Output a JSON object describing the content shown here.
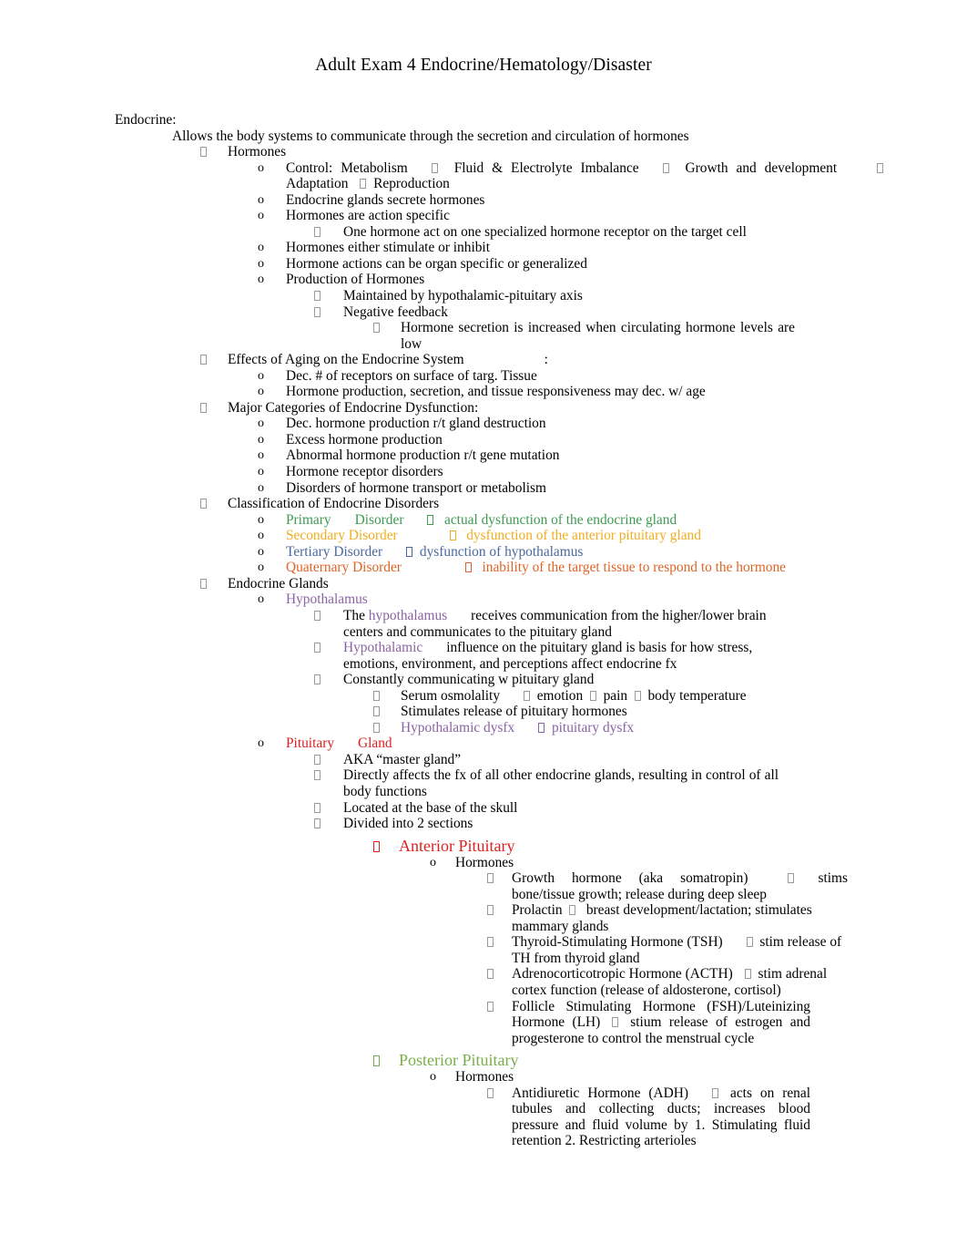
{
  "document": {
    "title": "Adult Exam 4 Endocrine/Hematology/Disaster",
    "bullet_glyph": "",
    "o_marker": "o",
    "colors": {
      "primary_green": "#3e9b52",
      "secondary_gold": "#f0ad1f",
      "tertiary_blue": "#49699e",
      "quaternary_orange": "#df6325",
      "hypothalamus_purple": "#8a63a3",
      "pituitary_red": "#dd2020",
      "posterior_green": "#79ad4b",
      "body_text": "#000000",
      "page_background": "#ffffff"
    }
  },
  "content": {
    "heading": "Endocrine:",
    "intro": "Allows the body systems to communicate through the secretion and circulation of hormones",
    "hormones_heading": "Hormones",
    "control_a": "Control: Metabolism",
    "control_b": "Fluid & Electrolyte Imbalance",
    "control_c": "Growth and development",
    "control_d": "Adaptation",
    "control_e": "Reproduction",
    "glands_secrete": "Endocrine glands secrete hormones",
    "action_specific": "Hormones are action specific",
    "one_hormone": "One hormone act on one specialized hormone receptor on the target cell",
    "stimulate_inhibit": "Hormones either stimulate or inhibit",
    "organ_specific": "Hormone actions can be organ specific or generalized",
    "production_of_hormones": "Production of Hormones",
    "maintained_by": "Maintained by hypothalamic-pituitary axis",
    "negative_feedback": "Negative feedback",
    "secretion_increased": "Hormone secretion is increased when circulating hormone levels are low",
    "effects_of_aging": "Effects of Aging on the Endocrine System",
    "effects_of_aging_colon": ":",
    "dec_receptors": "Dec. # of receptors on surface of targ. Tissue",
    "hormone_production_dec": "Hormone production, secretion, and tissue responsiveness may dec. w/ age",
    "major_categories": "Major Categories of Endocrine Dysfunction:",
    "dec_hormone_production": "Dec. hormone production r/t gland destruction",
    "excess_hormone": "Excess hormone production",
    "abnormal_hormone": "Abnormal hormone production r/t gene mutation",
    "receptor_disorders": "Hormone receptor disorders",
    "transport_disorders": "Disorders of hormone transport or metabolism",
    "classification": "Classification of Endocrine Disorders",
    "primary_label": "Primary",
    "primary_label2": "Disorder",
    "primary_def": "actual dysfunction of the endocrine gland",
    "secondary_label": "Secondary Disorder",
    "secondary_def": "dysfunction of the anterior pituitary gland",
    "tertiary_label": "Tertiary Disorder",
    "tertiary_def": "dysfunction of hypothalamus",
    "quaternary_label": "Quaternary Disorder",
    "quaternary_def": "inability of the target tissue to respond to the hormone",
    "endocrine_glands": "Endocrine Glands",
    "hypothalamus": "Hypothalamus",
    "the_word": "The",
    "hypothalamus_word": "hypothalamus",
    "receives_communication": "receives communication from the higher/lower brain centers and communicates to the pituitary gland",
    "hypothalamic_word": "Hypothalamic",
    "influence_on": "influence on the pituitary gland is basis for how stress, emotions, environment, and perceptions affect endocrine fx",
    "constantly_communicating": "Constantly communicating w pituitary gland",
    "serum_osmolality": "Serum osmolality",
    "emotion": "emotion",
    "pain": "pain",
    "body_temperature": "body temperature",
    "stimulates_release": "Stimulates release of pituitary hormones",
    "hypothalamic_dysfx": "Hypothalamic dysfx",
    "pituitary_dysfx": "pituitary dysfx",
    "pituitary_word": "Pituitary",
    "gland_word": "Gland",
    "aka_master_gland": "AKA “master gland”",
    "directly_affects": "Directly affects the fx of all other endocrine glands, resulting in control of all body functions",
    "located_at_base": "Located at the base of the skull",
    "divided_into_2": "Divided into 2 sections",
    "anterior_pituitary": "Anterior Pituitary",
    "hormones_label": "Hormones",
    "growth_hormone": "Growth hormone (aka somatropin)",
    "growth_hormone_def": "stims bone/tissue growth; release during deep sleep",
    "prolactin": "Prolactin",
    "prolactin_def": "breast development/lactation; stimulates mammary glands",
    "tsh": "Thyroid-Stimulating Hormone (TSH)",
    "tsh_def": "stim release of TH from thyroid gland",
    "acth": "Adrenocorticotropic Hormone (ACTH)",
    "acth_def": "stim adrenal cortex function (release of aldosterone, cortisol)",
    "fsh_lh": "Follicle Stimulating Hormone (FSH)/Luteinizing Hormone (LH)",
    "fsh_lh_def": "stium release of estrogen and progesterone to control the menstrual cycle",
    "posterior_pituitary": "Posterior Pituitary",
    "hormones_label2": "Hormones",
    "adh": "Antidiuretic Hormone (ADH)",
    "adh_def": "acts on renal tubules and collecting ducts; increases blood pressure and fluid volume by 1. Stimulating fluid retention 2. Restricting arterioles"
  }
}
